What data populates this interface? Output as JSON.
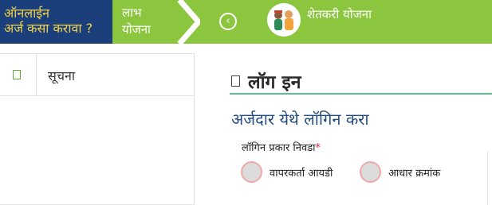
{
  "header": {
    "how_to_apply": {
      "line1": "ऑनलाईन",
      "line2": "अर्ज कसा करावा ?"
    },
    "benefit_scheme": {
      "line1": "लाभ",
      "line2": "योजना"
    },
    "back_icon": "chevron-left-icon",
    "scheme_name": "शेतकरी योजना",
    "colors": {
      "banner_green": "#8cc63f",
      "navy": "#1b3f7a",
      "yellow_text": "#f2d24a"
    }
  },
  "sidebar": {
    "items": [
      {
        "label": "सूचना",
        "icon": "document-icon"
      }
    ]
  },
  "main": {
    "title": "लॉग इन",
    "subtitle": "अर्जदार येथे लॉगिन करा",
    "login_type_label": "लॉगिन प्रकार निवडा",
    "required_mark": "*",
    "options": [
      {
        "label": "वापरकर्ता आयडी",
        "selected": false
      },
      {
        "label": "आधार क्रमांक",
        "selected": false
      }
    ]
  }
}
